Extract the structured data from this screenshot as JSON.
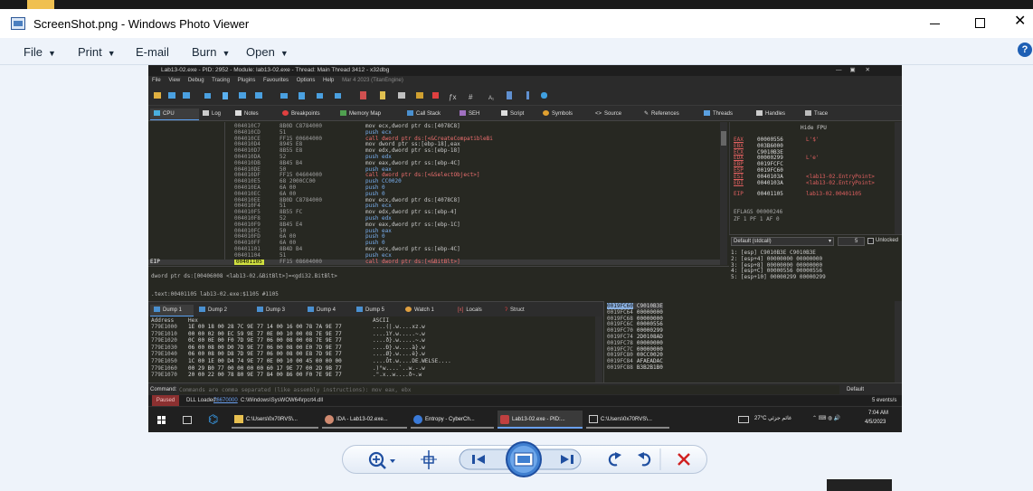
{
  "window": {
    "title": "ScreenShot.png - Windows Photo Viewer"
  },
  "menu": {
    "file": "File",
    "print": "Print",
    "email": "E-mail",
    "burn": "Burn",
    "open": "Open"
  },
  "dbg": {
    "title": "Lab13-02.exe - PID: 2952 - Module: lab13-02.exe - Thread: Main Thread 3412 - x32dbg",
    "menus": [
      "File",
      "View",
      "Debug",
      "Tracing",
      "Plugins",
      "Favourites",
      "Options",
      "Help",
      "Mar 4 2023 (TitanEngine)"
    ],
    "tabs": [
      "CPU",
      "Log",
      "Notes",
      "Breakpoints",
      "Memory Map",
      "Call Stack",
      "SEH",
      "Script",
      "Symbols",
      "Source",
      "References",
      "Threads",
      "Handles",
      "Trace"
    ],
    "eip_label": "EIP",
    "disasm": [
      {
        "a": "004010C7",
        "b": "8B0D C8784000",
        "i": "mov ecx,dword ptr ds:[4078C8]"
      },
      {
        "a": "004010CD",
        "b": "51",
        "i": "push ecx"
      },
      {
        "a": "004010CE",
        "b": "FF15 00604000",
        "i": "call dword ptr ds:[<&CreateCompatibleBi"
      },
      {
        "a": "004010D4",
        "b": "8945 E8",
        "i": "mov dword ptr ss:[ebp-18],eax"
      },
      {
        "a": "004010D7",
        "b": "8B55 E8",
        "i": "mov edx,dword ptr ss:[ebp-18]"
      },
      {
        "a": "004010DA",
        "b": "52",
        "i": "push edx"
      },
      {
        "a": "004010DB",
        "b": "8B45 B4",
        "i": "mov eax,dword ptr ss:[ebp-4C]"
      },
      {
        "a": "004010DE",
        "b": "50",
        "i": "push eax"
      },
      {
        "a": "004010DF",
        "b": "FF15 04604000",
        "i": "call dword ptr ds:[<&SelectObject>]"
      },
      {
        "a": "004010E5",
        "b": "68 2000CC00",
        "i": "push CC0020"
      },
      {
        "a": "004010EA",
        "b": "6A 00",
        "i": "push 0"
      },
      {
        "a": "004010EC",
        "b": "6A 00",
        "i": "push 0"
      },
      {
        "a": "004010EE",
        "b": "8B0D C8784000",
        "i": "mov ecx,dword ptr ds:[4078C8]"
      },
      {
        "a": "004010F4",
        "b": "51",
        "i": "push ecx"
      },
      {
        "a": "004010F5",
        "b": "8B55 FC",
        "i": "mov edx,dword ptr ss:[ebp-4]"
      },
      {
        "a": "004010F8",
        "b": "52",
        "i": "push edx"
      },
      {
        "a": "004010F9",
        "b": "8B45 E4",
        "i": "mov eax,dword ptr ss:[ebp-1C]"
      },
      {
        "a": "004010FC",
        "b": "50",
        "i": "push eax"
      },
      {
        "a": "004010FD",
        "b": "6A 00",
        "i": "push 0"
      },
      {
        "a": "004010FF",
        "b": "6A 00",
        "i": "push 0"
      },
      {
        "a": "00401101",
        "b": "8B4D B4",
        "i": "mov ecx,dword ptr ss:[ebp-4C]"
      },
      {
        "a": "00401104",
        "b": "51",
        "i": "push ecx"
      },
      {
        "a": "00401105",
        "b": "FF15 08604000",
        "i": "call dword ptr ds:[<&BitBlt>]"
      }
    ],
    "info_line1": "dword ptr ds:[00406008 <lab13-02.&BitBlt>]=<gdi32.BitBlt>",
    "info_line2": ".text:00401105 lab13-02.exe:$1105 #1105",
    "hide_fpu": "Hide FPU",
    "regs": [
      {
        "n": "EAX",
        "v": "00000556",
        "c": "L'$'"
      },
      {
        "n": "EBX",
        "v": "003B6000",
        "c": ""
      },
      {
        "n": "ECX",
        "v": "C9010B3E",
        "c": ""
      },
      {
        "n": "EDX",
        "v": "00000299",
        "c": "L'e'"
      },
      {
        "n": "EBP",
        "v": "0019FCFC",
        "c": ""
      },
      {
        "n": "ESP",
        "v": "0019FC60",
        "c": ""
      },
      {
        "n": "ESI",
        "v": "0040103A",
        "c": "<lab13-02.EntryPoint>"
      },
      {
        "n": "EDI",
        "v": "0040103A",
        "c": "<lab13-02.EntryPoint>"
      }
    ],
    "eip_reg": {
      "n": "EIP",
      "v": "00401105",
      "c": "lab13-02.00401105"
    },
    "eflags": "EFLAGS 00000246",
    "flags": "ZF 1  PF 1  AF 0",
    "callconv": "Default (stdcall)",
    "callnum": "5",
    "unlocked": "Unlocked",
    "callstack": [
      "1: [esp] C9010B3E C9010B3E",
      "2: [esp+4] 00000000 00000000",
      "3: [esp+8] 00000000 00000000",
      "4: [esp+C] 00000556 00000556",
      "5: [esp+10] 00000299 00000299"
    ],
    "dump_tabs": [
      "Dump 1",
      "Dump 2",
      "Dump 3",
      "Dump 4",
      "Dump 5",
      "Watch 1",
      "Locals",
      "Struct"
    ],
    "dump_header": {
      "addr": "Address",
      "hex": "Hex",
      "ascii": "ASCII"
    },
    "dump_rows": [
      {
        "a": "779E1000",
        "h": "1E 00 18 00 28 7C 9E 77 14 00 16 00 78 7A 9E 77",
        "s": "....(|.w....xz.w"
      },
      {
        "a": "779E1010",
        "h": "00 00 02 00 EC 59 9E 77 0E 00 10 00 08 7E 9E 77",
        "s": "....ìY.w.....~.w"
      },
      {
        "a": "779E1020",
        "h": "0C 00 0E 00 F0 7D 9E 77 06 00 08 00 08 7E 9E 77",
        "s": "....ð}.w.....~.w"
      },
      {
        "a": "779E1030",
        "h": "06 00 08 00 D0 7D 9E 77 06 00 08 00 E0 7D 9E 77",
        "s": "....Ð}.w....à}.w"
      },
      {
        "a": "779E1040",
        "h": "06 00 08 00 D8 7D 9E 77 06 00 08 00 E8 7D 9E 77",
        "s": "....Ø}.w....è}.w"
      },
      {
        "a": "779E1050",
        "h": "1C 00 1E 00 D4 74 9E 77 0E 00 10 00 45 00 00 00",
        "s": "....Ôt.w....DE.WELSE...."
      },
      {
        "a": "779E1060",
        "h": "00 29 B0 77 00 00 00 00 60 17 9E 77 00 2D 9B 77",
        "s": ".)°w....`..w.-.w"
      },
      {
        "a": "779E1070",
        "h": "20 00 22 00 78 80 9E 77 84 00 86 00 F0 7E 9E 77",
        "s": " .\".x..w....ð~.w"
      }
    ],
    "stack_rows": [
      {
        "a": "0019FC60",
        "v": "C9010B3E"
      },
      {
        "a": "0019FC64",
        "v": "00000000"
      },
      {
        "a": "0019FC68",
        "v": "00000000"
      },
      {
        "a": "0019FC6C",
        "v": "00000556"
      },
      {
        "a": "0019FC70",
        "v": "00000299"
      },
      {
        "a": "0019FC74",
        "v": "2D0108AD"
      },
      {
        "a": "0019FC78",
        "v": "00000000"
      },
      {
        "a": "0019FC7C",
        "v": "00000000"
      },
      {
        "a": "0019FC80",
        "v": "00CC0020"
      },
      {
        "a": "0019FC84",
        "v": "AFAEADAC"
      },
      {
        "a": "0019FC88",
        "v": "B3B2B1B0"
      }
    ],
    "command_label": "Command:",
    "command_placeholder": "Commands are comma separated (like assembly instructions): mov eax, ebx",
    "command_default": "Default",
    "status_paused": "Paused",
    "status_dll": "DLL Loaded:",
    "status_dll_addr": "76670000",
    "status_dll_path": "C:\\Windows\\SysWOW64\\rpcrt4.dll",
    "status_events": "5 events/s"
  },
  "taskbar": {
    "items": [
      "C:\\Users\\0x70RVS\\...",
      "IDA - Lab13-02.exe...",
      "Entropy - CyberCh...",
      "Lab13-02.exe - PID:...",
      "C:\\Users\\0x70RVS\\..."
    ],
    "weather": "27°C  غائم جزئي",
    "time": "7:04 AM",
    "date": "4/5/2023"
  }
}
